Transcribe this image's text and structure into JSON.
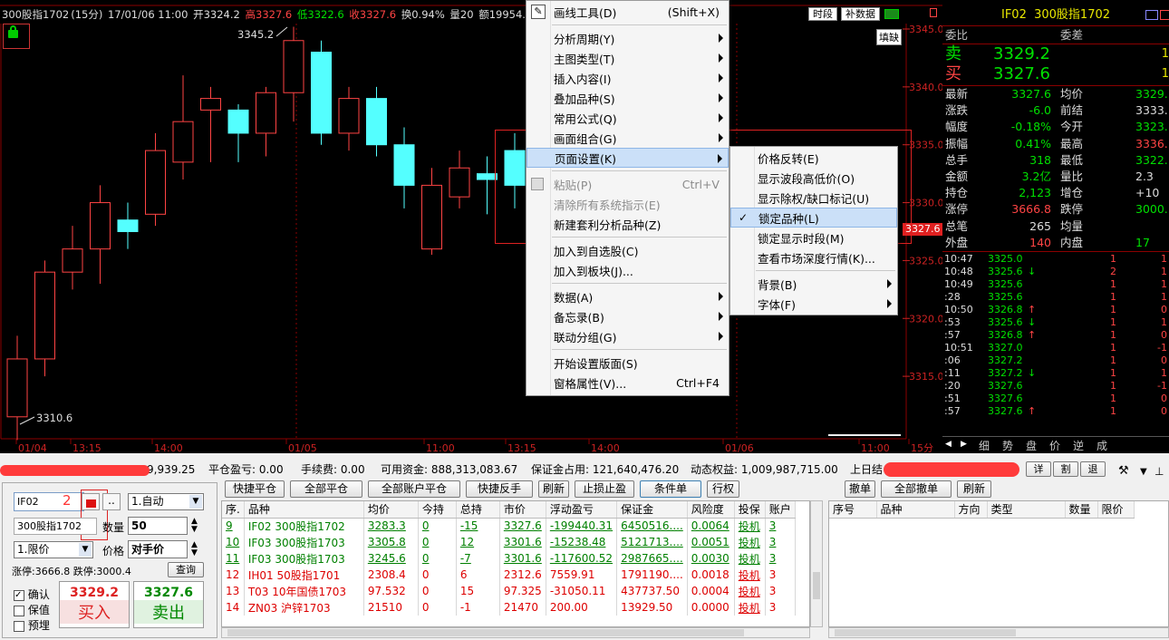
{
  "chart": {
    "title": {
      "name": "300股指1702",
      "period": "(15分)",
      "date": "17/01/06 11:00",
      "open": "开3324.2",
      "high": "高3327.6",
      "low": "低3322.6",
      "close": "收3327.6",
      "turnover": "换0.94%",
      "vol": "量20",
      "amount": "额19954.."
    },
    "btn_period": "时段",
    "btn_data": "补数据",
    "fill_gap": "填缺",
    "high_label": "3345.2",
    "low_label": "3310.6",
    "price_ticks": [
      "3345.0",
      "3340.0",
      "3335.0",
      "3330.0",
      "3325.0",
      "3320.0",
      "3315.0"
    ],
    "current_price": "3327.6",
    "x_ticks": [
      "01/04",
      "13:15",
      "14:00",
      "01/05",
      "11:00",
      "13:15",
      "14:00",
      "01/06",
      "11:00",
      "15分"
    ],
    "annotation_1": "1",
    "candles": [
      {
        "o": 3311.5,
        "c": 3316.5,
        "h": 3318.5,
        "l": 3309.5
      },
      {
        "o": 3316.5,
        "c": 3324.0,
        "h": 3325.0,
        "l": 3315.0
      },
      {
        "o": 3324.0,
        "c": 3326.0,
        "h": 3328.0,
        "l": 3322.5
      },
      {
        "o": 3326.0,
        "c": 3330.0,
        "h": 3331.5,
        "l": 3323.0
      },
      {
        "o": 3328.5,
        "c": 3327.5,
        "h": 3330.0,
        "l": 3326.0
      },
      {
        "o": 3329.0,
        "c": 3334.5,
        "h": 3336.0,
        "l": 3328.0
      },
      {
        "o": 3333.5,
        "c": 3337.0,
        "h": 3341.0,
        "l": 3332.0
      },
      {
        "o": 3338.0,
        "c": 3339.0,
        "h": 3340.0,
        "l": 3333.5
      },
      {
        "o": 3338.0,
        "c": 3336.0,
        "h": 3338.5,
        "l": 3333.5
      },
      {
        "o": 3336.0,
        "c": 3339.5,
        "h": 3340.0,
        "l": 3334.0
      },
      {
        "o": 3339.5,
        "c": 3344.0,
        "h": 3345.2,
        "l": 3337.0
      },
      {
        "o": 3343.0,
        "c": 3336.0,
        "h": 3344.0,
        "l": 3335.0
      },
      {
        "o": 3336.0,
        "c": 3339.0,
        "h": 3340.0,
        "l": 3334.5
      },
      {
        "o": 3339.0,
        "c": 3335.0,
        "h": 3340.0,
        "l": 3334.0
      },
      {
        "o": 3335.0,
        "c": 3331.5,
        "h": 3336.5,
        "l": 3329.5
      },
      {
        "o": 3326.0,
        "c": 3331.5,
        "h": 3333.0,
        "l": 3325.5
      },
      {
        "o": 3330.5,
        "c": 3333.0,
        "h": 3334.5,
        "l": 3329.5
      },
      {
        "o": 3332.5,
        "c": 3332.0,
        "h": 3334.0,
        "l": 3329.0
      },
      {
        "o": 3334.5,
        "c": 3331.5,
        "h": 3336.0,
        "l": 3329.5
      }
    ]
  },
  "menu": {
    "draw_tools": "画线工具(D)",
    "draw_tools_key": "(Shift+X)",
    "items1": [
      {
        "l": "分析周期(Y)"
      },
      {
        "l": "主图类型(T)"
      },
      {
        "l": "插入内容(I)"
      },
      {
        "l": "叠加品种(S)"
      },
      {
        "l": "常用公式(Q)"
      },
      {
        "l": "画面组合(G)"
      },
      {
        "l": "页面设置(K)"
      }
    ],
    "paste": "粘贴(P)",
    "paste_key": "Ctrl+V",
    "clear": "清除所有系统指示(E)",
    "new_arb": "新建套利分析品种(Z)",
    "add_watch": "加入到自选股(C)",
    "add_block": "加入到板块(J)...",
    "items2": [
      {
        "l": "数据(A)"
      },
      {
        "l": "备忘录(B)"
      },
      {
        "l": "联动分组(G)"
      }
    ],
    "start_layout": "开始设置版面(S)",
    "win_prop": "窗格属性(V)...",
    "win_prop_key": "Ctrl+F4",
    "sub": {
      "items": [
        "价格反转(E)",
        "显示波段高低价(O)",
        "显示除权/缺口标记(U)",
        "锁定品种(L)",
        "锁定显示时段(M)",
        "查看市场深度行情(K)..."
      ],
      "bg": "背景(B)",
      "font": "字体(F)"
    }
  },
  "quote": {
    "code": "IF02",
    "name": "300股指1702",
    "wb": "委比",
    "wc": "委差",
    "sell": "卖",
    "buy": "买",
    "sell_p": "3329.2",
    "buy_p": "3327.6",
    "sell_v": "1",
    "buy_v": "1",
    "rows": [
      [
        "最新",
        "3327.6",
        "均价",
        "3329."
      ],
      [
        "涨跌",
        "-6.0",
        "前结",
        "3333."
      ],
      [
        "幅度",
        "-0.18%",
        "今开",
        "3323."
      ],
      [
        "振幅",
        "0.41%",
        "最高",
        "3336."
      ],
      [
        "总手",
        "318",
        "最低",
        "3322."
      ],
      [
        "金额",
        "3.2亿",
        "量比",
        "2.3"
      ],
      [
        "持仓",
        "2,123",
        "增仓",
        "+10"
      ],
      [
        "涨停",
        "3666.8",
        "跌停",
        "3000."
      ],
      [
        "总笔",
        "265",
        "均量",
        ""
      ],
      [
        "外盘",
        "140",
        "内盘",
        "17"
      ]
    ],
    "ticks": [
      [
        "10:47",
        "3325.0",
        "",
        "1",
        "1"
      ],
      [
        "10:48",
        "3325.6",
        "↓",
        "2",
        "1"
      ],
      [
        "10:49",
        "3325.6",
        "",
        "1",
        "1"
      ],
      [
        ":28",
        "3325.6",
        "",
        "1",
        "1"
      ],
      [
        "10:50",
        "3326.8",
        "↑",
        "1",
        "0"
      ],
      [
        ":53",
        "3325.6",
        "↓",
        "1",
        "1"
      ],
      [
        ":57",
        "3326.8",
        "↑",
        "1",
        "0"
      ],
      [
        "10:51",
        "3327.0",
        "",
        "1",
        "-1"
      ],
      [
        ":06",
        "3327.2",
        "",
        "1",
        "0"
      ],
      [
        ":11",
        "3327.2",
        "↓",
        "1",
        "1"
      ],
      [
        ":20",
        "3327.6",
        "",
        "1",
        "-1"
      ],
      [
        ":51",
        "3327.6",
        "",
        "1",
        "0"
      ],
      [
        ":57",
        "3327.6",
        "↑",
        "1",
        "0"
      ]
    ],
    "tabs": [
      "细",
      "势",
      "盘",
      "价",
      "逆",
      "成"
    ]
  },
  "bottom": {
    "status": {
      "a": "9,939.25",
      "pl": "平仓盈亏: 0.00",
      "fee": "手续费: 0.00",
      "avail": "可用资金: 888,313,083.67",
      "margin": "保证金占用: 121,640,476.20",
      "eq": "动态权益: 1,009,987,715.00",
      "prev": "上日结"
    },
    "rt_btns": [
      "详",
      "割",
      "退"
    ],
    "order": {
      "code": "IF02",
      "ann2": "2",
      "mode": "1.自动",
      "name": "300股指1702",
      "qty_l": "数量",
      "qty": "50",
      "ptype": "1.限价",
      "price_l": "价格",
      "price": "对手价",
      "limits": "涨停:3666.8 跌停:3000.4",
      "query": "查询",
      "confirm": "确认",
      "protect": "保值",
      "prebuy": "预埋",
      "buy_p": "3329.2",
      "buy": "买入",
      "sell_p": "3327.6",
      "sell": "卖出"
    },
    "pos_btns": [
      "快捷平仓",
      "全部平仓",
      "全部账户平仓",
      "快捷反手",
      "刷新",
      "止损止盈",
      "条件单",
      "行权"
    ],
    "pos_headers": [
      "序.",
      "品种",
      "均价",
      "今持",
      "总持",
      "市价",
      "浮动盈亏",
      "保证金",
      "风险度",
      "投保",
      "账户"
    ],
    "pos_rows": [
      [
        "9",
        "IF02 300股指1702",
        "3283.3",
        "0",
        "-15",
        "3327.6",
        "-199440.31",
        "6450516....",
        "0.0064",
        "投机",
        "3"
      ],
      [
        "10",
        "IF03 300股指1703",
        "3305.8",
        "0",
        "12",
        "3301.6",
        "-15238.48",
        "5121713....",
        "0.0051",
        "投机",
        "3"
      ],
      [
        "11",
        "IF03 300股指1703",
        "3245.6",
        "0",
        "-7",
        "3301.6",
        "-117600.52",
        "2987665....",
        "0.0030",
        "投机",
        "3"
      ],
      [
        "12",
        "IH01 50股指1701",
        "2308.4",
        "0",
        "6",
        "2312.6",
        "7559.91",
        "1791190....",
        "0.0018",
        "投机",
        "3"
      ],
      [
        "13",
        "T03 10年国债1703",
        "97.532",
        "0",
        "15",
        "97.325",
        "-31050.11",
        "437737.50",
        "0.0004",
        "投机",
        "3"
      ],
      [
        "14",
        "ZN03 沪锌1703",
        "21510",
        "0",
        "-1",
        "21470",
        "200.00",
        "13929.50",
        "0.0000",
        "投机",
        "3"
      ]
    ],
    "ord_btns": [
      "撤单",
      "全部撤单",
      "刷新"
    ],
    "ord_headers": [
      "序号",
      "品种",
      "方向",
      "类型",
      "数量",
      "限价"
    ]
  },
  "colors": {
    "up": "#ff4444",
    "down": "#54ffff",
    "grid": "#8b0000",
    "menu_hl": "#cbe0f8"
  }
}
